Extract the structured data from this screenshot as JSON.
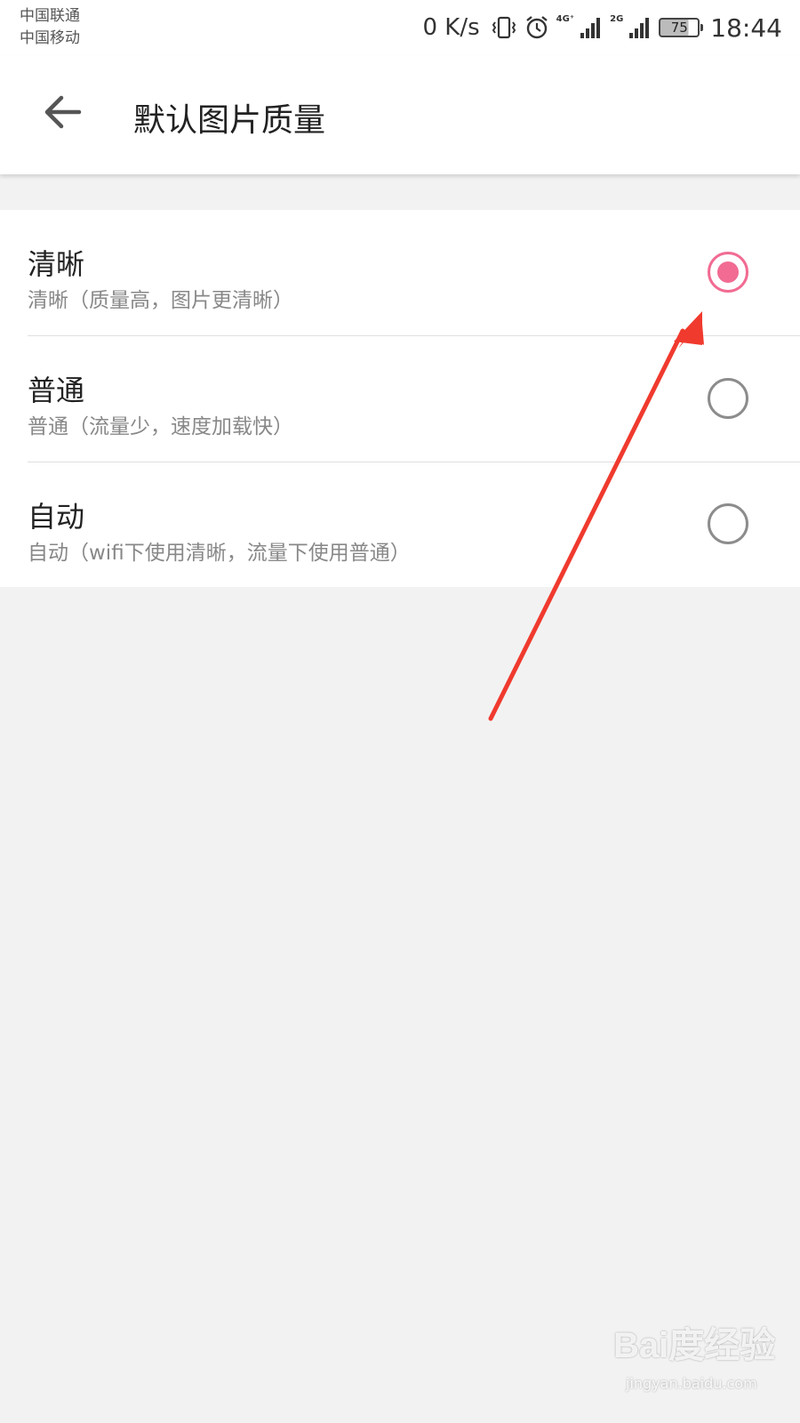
{
  "status_bar": {
    "carrier1": "中国联通",
    "carrier2": "中国移动",
    "speed": "0 K/s",
    "net1": "4G⁺",
    "net2": "2G",
    "battery": "75",
    "time": "18:44"
  },
  "header": {
    "title": "默认图片质量",
    "back_icon": "arrow-left-icon"
  },
  "options": [
    {
      "title": "清晰",
      "desc": "清晰（质量高，图片更清晰）",
      "selected": true
    },
    {
      "title": "普通",
      "desc": "普通（流量少，速度加载快）",
      "selected": false
    },
    {
      "title": "自动",
      "desc": "自动（wifi下使用清晰，流量下使用普通）",
      "selected": false
    }
  ],
  "colors": {
    "accent": "#f16b93",
    "annotation_arrow": "#f03a2e",
    "background": "#f2f2f2"
  },
  "watermark": {
    "logo": "Bai度经验",
    "url": "jingyan.baidu.com"
  }
}
